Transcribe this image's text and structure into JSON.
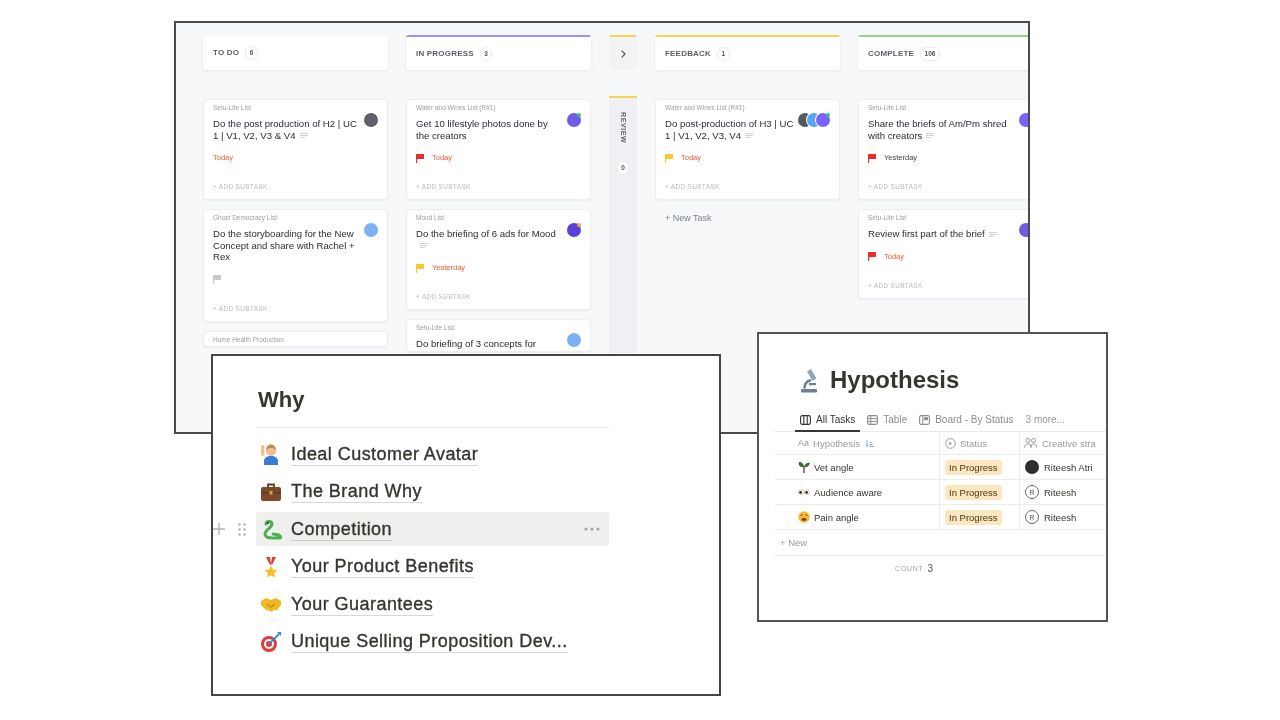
{
  "kanban": {
    "columns": [
      {
        "name": "TO DO",
        "count": "6",
        "collapsed": false,
        "cards": [
          {
            "list": "Setu-Life List",
            "title": "Do the post production of H2 | UC 1 | V1, V2, V3 & V4",
            "note_icon": true,
            "avatars": [
              {
                "color": "#5f6168"
              }
            ],
            "due": {
              "text": "Today",
              "overdue": true
            },
            "add_subtask": "+ ADD SUBTASK"
          },
          {
            "list": "Ghost Democracy List",
            "title": "Do the storyboarding for the New Concept and share with Rachel + Rex",
            "avatars": [
              {
                "color": "#7db0f5"
              }
            ],
            "flag": {
              "color": "#c4c7cc"
            },
            "add_subtask": "+ ADD SUBTASK"
          },
          {
            "list": "Hume Health Production"
          }
        ]
      },
      {
        "name": "IN PROGRESS",
        "count": "3",
        "collapsed": false,
        "color": "#a48cf2",
        "cards": [
          {
            "list": "Water and Wines List (R#1)",
            "title": "Get 10 lifestyle photos done by the creators",
            "avatars": [
              {
                "color": "#6c5ce7",
                "status": {
                  "color": "#2ecc71"
                }
              }
            ],
            "flag": {
              "color": "#e62e2e"
            },
            "due": {
              "text": "Today",
              "overdue": true
            },
            "add_subtask": "+ ADD SUBTASK"
          },
          {
            "list": "Mood List",
            "title": "Do the briefing of 6 ads for Mood",
            "note_icon": true,
            "avatars": [
              {
                "color": "#5b3fd9",
                "status": {
                  "color": "#f5a623"
                }
              }
            ],
            "flag": {
              "color": "#f7c72d"
            },
            "due": {
              "text": "Yesterday",
              "overdue": true
            },
            "add_subtask": "+ ADD SUBTASK"
          },
          {
            "list": "Setu-Life List",
            "title": "Do briefing of 3 concepts for",
            "avatars": [
              {
                "color": "#7db0f5"
              }
            ]
          }
        ]
      },
      {
        "name": "REVIEW",
        "count": "0",
        "collapsed": true,
        "color": "#f5d451"
      },
      {
        "name": "FEEDBACK",
        "count": "1",
        "collapsed": false,
        "color": "#f5d451",
        "cards": [
          {
            "list": "Water and Wines List (R#1)",
            "title": "Do post-production of H3 | UC 1 | V1, V2, V3, V4",
            "note_icon": true,
            "avatars": [
              {
                "color": "#55585e"
              },
              {
                "color": "#5aa2f5"
              },
              {
                "color": "#7b61ff",
                "status": {
                  "color": "#2ecc71"
                }
              }
            ],
            "flag": {
              "color": "#f7c72d"
            },
            "due": {
              "text": "Today",
              "overdue": true
            },
            "add_subtask": "+ ADD SUBTASK"
          }
        ],
        "new_task": "+ New Task"
      },
      {
        "name": "COMPLETE",
        "count": "106",
        "collapsed": false,
        "color": "#8fd48a",
        "cards": [
          {
            "list": "Setu-Life List",
            "title": "Share the briefs of Am/Pm shred with creators",
            "note_icon": true,
            "avatars": [
              {
                "color": "#7b61ff"
              }
            ],
            "flag": {
              "color": "#e62e2e"
            },
            "due": {
              "text": "Yesterday",
              "overdue": false
            },
            "add_subtask": "+ ADD SUBTASK"
          },
          {
            "list": "Setu-Life List",
            "title": "Review first part of the brief",
            "note_icon": true,
            "avatars": [
              {
                "color": "#6c5ce7"
              }
            ],
            "flag": {
              "color": "#e62e2e"
            },
            "due": {
              "text": "Today",
              "overdue": true
            },
            "add_subtask": "+ ADD SUBTASK"
          }
        ]
      }
    ]
  },
  "why": {
    "title": "Why",
    "items": [
      {
        "label": "Ideal Customer Avatar",
        "selected": false
      },
      {
        "label": "The Brand Why",
        "selected": false
      },
      {
        "label": "Competition",
        "selected": true
      },
      {
        "label": "Your Product Benefits",
        "selected": false
      },
      {
        "label": "Your Guarantees",
        "selected": false
      },
      {
        "label": "Unique Selling Proposition Dev...",
        "selected": false
      }
    ]
  },
  "hypothesis": {
    "title": "Hypothesis",
    "tabs": [
      {
        "label": "All Tasks",
        "selected": true
      },
      {
        "label": "Table",
        "selected": false
      },
      {
        "label": "Board - By Status",
        "selected": false
      }
    ],
    "more": "3 more...",
    "table": {
      "columns": [
        {
          "icon_text": "Aa",
          "label": "Hypothesis",
          "sorted": true
        },
        {
          "label": "Status",
          "sorted": false
        },
        {
          "label": "Creative stra",
          "sorted": false
        }
      ],
      "rows": [
        {
          "name": "Vet angle",
          "status": "In Progress",
          "person": {
            "name": "Riteesh Atri",
            "avatar": {
              "kind": "photo"
            }
          }
        },
        {
          "name": "Audience aware",
          "status": "In Progress",
          "person": {
            "name": "Riteesh",
            "avatar": {
              "kind": "letter",
              "text": "R"
            }
          }
        },
        {
          "name": "Pain angle",
          "status": "In Progress",
          "person": {
            "name": "Riteesh",
            "avatar": {
              "kind": "letter",
              "text": "R"
            }
          }
        }
      ],
      "new_row": "+ New",
      "count": {
        "label": "COUNT",
        "value": "3"
      }
    }
  }
}
